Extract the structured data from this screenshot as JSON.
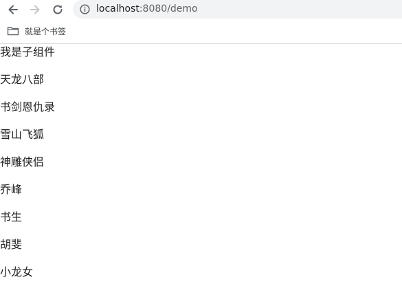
{
  "browser": {
    "url_host": "localhost",
    "url_rest": ":8080/demo",
    "bookmarks": [
      {
        "label": "就是个书签"
      }
    ]
  },
  "page": {
    "child_title": "我是子组件",
    "books": [
      "天龙八部",
      "书剑恩仇录",
      "雪山飞狐",
      "神雕侠侣",
      "乔峰",
      "书生",
      "胡斐",
      "小龙女"
    ]
  },
  "colors": {
    "toolbar_bg": "#ffffff",
    "omnibox_bg": "#f1f3f4",
    "text_primary": "#222222",
    "icon_gray": "#5f6368",
    "icon_disabled": "#c4c6c9"
  }
}
